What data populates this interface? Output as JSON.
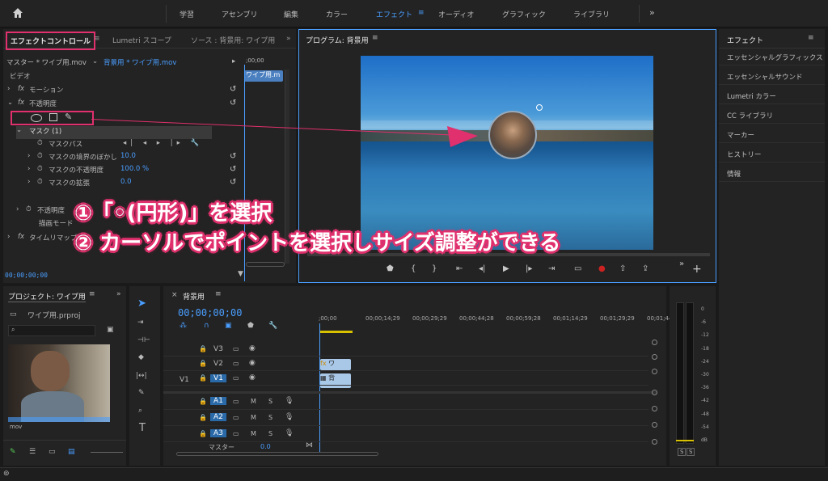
{
  "workspaces": [
    "学習",
    "アセンブリ",
    "編集",
    "カラー",
    "エフェクト",
    "オーディオ",
    "グラフィック",
    "ライブラリ"
  ],
  "effect_controls": {
    "tabs": [
      "エフェクトコントロール",
      "Lumetri スコープ",
      "ソース : 背景用: ワイプ用"
    ],
    "master": "マスター * ワイプ用.mov",
    "clip": "背景用 * ワイプ用.mov",
    "timecode_start": ";00;00",
    "clip_label": "ワイプ用.m",
    "video_label": "ビデオ",
    "motion": "モーション",
    "opacity": "不透明度",
    "mask": "マスク (1)",
    "mask_path": "マスクパス",
    "mask_feather": "マスクの境界のぼかし",
    "mask_feather_val": "10.0",
    "mask_opacity": "マスクの不透明度",
    "mask_opacity_val": "100.0 %",
    "mask_expansion": "マスクの拡張",
    "mask_expansion_val": "0.0",
    "opacity2": "不透明度",
    "blend_mode": "描画モード",
    "timeremap": "タイムリマップ",
    "timecode": "00;00;00;00"
  },
  "program": {
    "title": "プログラム: 背景用"
  },
  "effects_panel": {
    "title": "エフェクト",
    "items": [
      "エッセンシャルグラフィックス",
      "エッセンシャルサウンド",
      "Lumetri カラー",
      "CC ライブラリ",
      "マーカー",
      "ヒストリー",
      "情報"
    ]
  },
  "project": {
    "title": "プロジェクト: ワイプ用",
    "file": "ワイプ用.prproj",
    "thumb_label": "mov"
  },
  "timeline": {
    "tab": "背景用",
    "timecode": "00;00;00;00",
    "ruler": [
      ";00;00",
      "00;00;14;29",
      "00;00;29;29",
      "00;00;44;28",
      "00;00;59;28",
      "00;01;14;29",
      "00;01;29;29",
      "00;01;44;29"
    ],
    "video_tracks": [
      "V3",
      "V2",
      "V1"
    ],
    "audio_tracks": [
      "A1",
      "A2",
      "A3"
    ],
    "source_v": "V1",
    "master": "マスター",
    "master_val": "0.0",
    "clip_v2": "ワ",
    "clip_v1": "背"
  },
  "vu": {
    "labels": [
      "0",
      "-6",
      "-12",
      "-18",
      "-24",
      "-30",
      "-36",
      "-42",
      "-48",
      "-54",
      "dB"
    ],
    "solo": [
      "S",
      "S"
    ]
  },
  "annotation": {
    "line1": "①「◦(円形)」を選択",
    "line2": "② カーソルでポイントを選択しサイズ調整ができる"
  },
  "colors": {
    "accent": "#4a9eff",
    "highlight": "#e0306d"
  }
}
